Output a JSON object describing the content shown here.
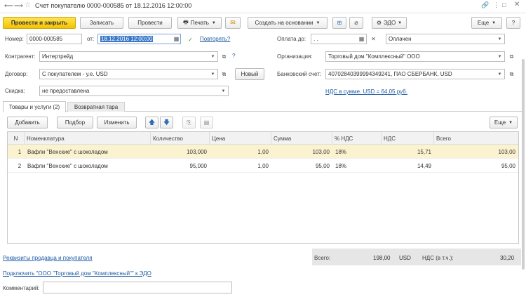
{
  "titlebar": {
    "title": "Счет покупателю 0000-000585 от 18.12.2016 12:00:00"
  },
  "toolbar": {
    "post_close": "Провести и закрыть",
    "save": "Записать",
    "post": "Провести",
    "print": "Печать",
    "create_based": "Создать на основании",
    "edo": "ЭДО",
    "more": "Еще",
    "help": "?"
  },
  "form": {
    "number_label": "Номер:",
    "number_value": "0000-000585",
    "date_label": "от:",
    "date_value": "18.12.2016 12:00:00",
    "repeat_link": "Повторять?",
    "payment_label": "Оплата до:",
    "payment_value": " .  .",
    "status_value": "Оплачен",
    "counterparty_label": "Контрагент:",
    "counterparty_value": "Интертрейд",
    "org_label": "Организация:",
    "org_value": "Торговый дом \"Комплексный\" ООО",
    "contract_label": "Договор:",
    "contract_value": "С покупателем - у.е. USD",
    "new_button": "Новый",
    "bank_label": "Банковский счет:",
    "bank_value": "40702840399994349241, ПАО СБЕРБАНК, USD",
    "vat_link": "НДС в сумме. USD = 64,05 руб.",
    "discount_label": "Скидка:",
    "discount_value": "не предоставлена"
  },
  "tabs": [
    {
      "label": "Товары и услуги (2)"
    },
    {
      "label": "Возвратная тара"
    }
  ],
  "table_toolbar": {
    "add": "Добавить",
    "pick": "Подбор",
    "change": "Изменить",
    "more": "Еще"
  },
  "table": {
    "headers": [
      "N",
      "Номенклатура",
      "Количество",
      "Цена",
      "Сумма",
      "% НДС",
      "НДС",
      "Всего"
    ],
    "rows": [
      {
        "n": "1",
        "item": "Вафли \"Венские\" с шоколадом",
        "qty": "103,000",
        "price": "1,00",
        "sum": "103,00",
        "vat_rate": "18%",
        "vat": "15,71",
        "total": "103,00"
      },
      {
        "n": "2",
        "item": "Вафли \"Венские\" с шоколадом",
        "qty": "95,000",
        "price": "1,00",
        "sum": "95,00",
        "vat_rate": "18%",
        "vat": "14,49",
        "total": "95,00"
      }
    ]
  },
  "footer": {
    "requisites_link": "Реквизиты продавца и покупателя",
    "total_label": "Всего:",
    "total_value": "198,00",
    "currency": "USD",
    "vat_incl_label": "НДС (в т.ч.):",
    "vat_incl_value": "30,20",
    "edo_link": "Подключить \"ООО \"Торговый дом \"Комплексный\"\" к ЭДО",
    "comment_label": "Комментарий:",
    "comment_value": ""
  },
  "colors": {
    "primary_button": "#f5c200",
    "selected_row": "#fbf3cf",
    "link": "#1f5ba3"
  }
}
